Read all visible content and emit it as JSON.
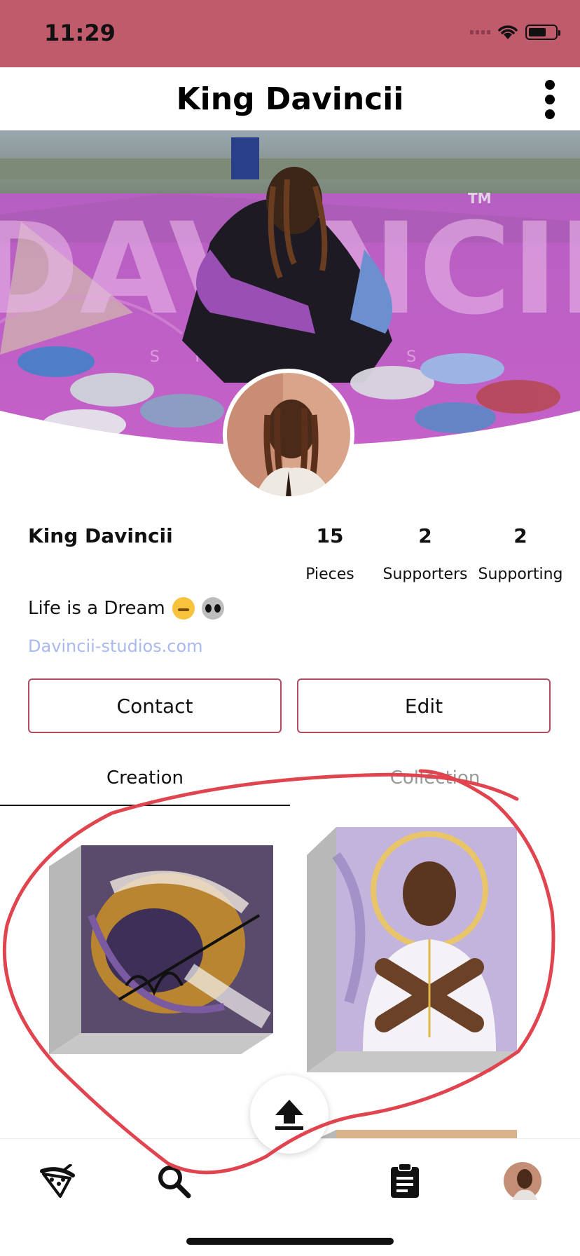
{
  "status_bar": {
    "time": "11:29"
  },
  "header": {
    "title": "King Davincii"
  },
  "profile": {
    "name": "King Davincii",
    "bio": "Life is a Dream",
    "bio_emojis": [
      "sleeping-face-emoji",
      "alien-emoji"
    ],
    "website": "Davincii-studios.com",
    "cover_watermark": "DAVINCII",
    "cover_watermark_sub": "S T U D I O S",
    "cover_tm": "TM"
  },
  "stats": [
    {
      "value": "15",
      "label": "Pieces"
    },
    {
      "value": "2",
      "label": "Supporters"
    },
    {
      "value": "2",
      "label": "Supporting"
    }
  ],
  "actions": {
    "contact_label": "Contact",
    "edit_label": "Edit"
  },
  "tabs": [
    {
      "label": "Creation",
      "active": true
    },
    {
      "label": "Collection",
      "active": false
    }
  ],
  "bottom_nav": {
    "items": [
      "paint-palette-icon",
      "search-icon",
      "upload-icon",
      "clipboard-icon",
      "profile-avatar"
    ]
  },
  "colors": {
    "status_bar": "#c05b6c",
    "button_border": "#b34b60",
    "link": "#a9b9f0",
    "annotation": "#e0454f",
    "cover_court": "#c05ec8"
  }
}
